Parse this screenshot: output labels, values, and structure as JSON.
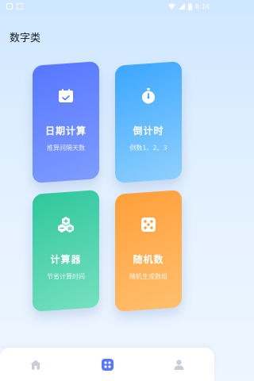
{
  "status_bar": {
    "time": "8:24",
    "left_icons": [
      "image-icon",
      "notification-icon"
    ],
    "right_icons": [
      "wifi-icon",
      "signal-icon",
      "battery-icon"
    ]
  },
  "page": {
    "title": "数字类"
  },
  "cards": [
    {
      "title": "日期计算",
      "subtitle": "推算间隔天数",
      "icon": "calendar-icon",
      "color": "#5677ff"
    },
    {
      "title": "倒计时",
      "subtitle": "倒数1、2、3",
      "icon": "stopwatch-icon",
      "color": "#3ba6ff"
    },
    {
      "title": "计算器",
      "subtitle": "节省计算时间",
      "icon": "calculator-icon",
      "color": "#2fc79c"
    },
    {
      "title": "随机数",
      "subtitle": "随机生成数组",
      "icon": "dice-icon",
      "color": "#ff9f3a"
    }
  ],
  "tabbar": {
    "tabs": [
      {
        "icon": "home-icon",
        "active": false
      },
      {
        "icon": "apps-icon",
        "active": true,
        "active_color": "#5677ff"
      },
      {
        "icon": "user-icon",
        "active": false
      }
    ]
  }
}
